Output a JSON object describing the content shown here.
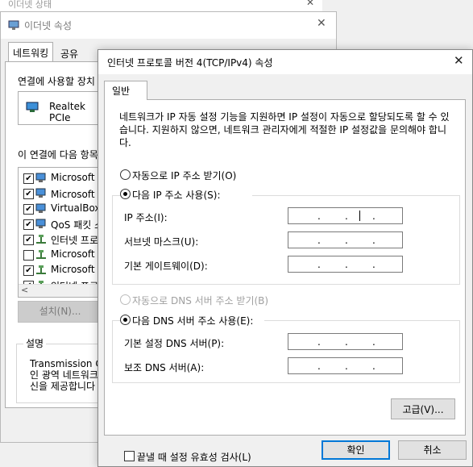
{
  "status_window": {
    "title": "이더넷 상태"
  },
  "properties_window": {
    "title": "이더넷 속성",
    "tabs": [
      "네트워킹",
      "공유"
    ],
    "connect_using_label": "연결에 사용할 장치",
    "adapter_name": "Realtek PCIe",
    "items_label": "이 연결에 다음 항목",
    "items": [
      {
        "label": "Microsoft N",
        "checked": true,
        "icon": "network-client-icon"
      },
      {
        "label": "Microsoft 파",
        "checked": true,
        "icon": "network-client-icon"
      },
      {
        "label": "VirtualBox",
        "checked": true,
        "icon": "network-client-icon"
      },
      {
        "label": "QoS 패킷 스",
        "checked": true,
        "icon": "network-client-icon"
      },
      {
        "label": "인터넷 프로",
        "checked": true,
        "icon": "protocol-icon"
      },
      {
        "label": "Microsoft I",
        "checked": false,
        "icon": "protocol-icon"
      },
      {
        "label": "Microsoft L",
        "checked": true,
        "icon": "protocol-icon"
      },
      {
        "label": "인터넷 프로",
        "checked": true,
        "icon": "protocol-icon"
      }
    ],
    "install_button": "설치(N)...",
    "description_title": "설명",
    "description_lines": [
      "Transmission Co",
      "인 광역 네트워크",
      "신을 제공합니다"
    ]
  },
  "ipv4_window": {
    "title": "인터넷 프로토콜 버전 4(TCP/IPv4) 속성",
    "close_glyph": "✕",
    "tab_general": "일반",
    "intro_text": "네트워크가 IP 자동 설정 기능을 지원하면 IP 설정이 자동으로 할당되도록 할 수 있습니다. 지원하지 않으면, 네트워크 관리자에게 적절한 IP 설정값을 문의해야 합니다.",
    "ip_auto": {
      "label": "자동으로 IP 주소 받기(O)",
      "selected": false
    },
    "ip_manual": {
      "label": "다음 IP 주소 사용(S):",
      "selected": true
    },
    "ip_fields": [
      {
        "label": "IP 주소(I):",
        "value": ". . ."
      },
      {
        "label": "서브넷 마스크(U):",
        "value": ". . ."
      },
      {
        "label": "기본 게이트웨이(D):",
        "value": ". . ."
      }
    ],
    "dns_auto": {
      "label": "자동으로 DNS 서버 주소 받기(B)",
      "selected": false,
      "disabled": true
    },
    "dns_manual": {
      "label": "다음 DNS 서버 주소 사용(E):",
      "selected": true
    },
    "dns_fields": [
      {
        "label": "기본 설정 DNS 서버(P):",
        "value": ". . ."
      },
      {
        "label": "보조 DNS 서버(A):",
        "value": ". . ."
      }
    ],
    "validate_label": "끝낼 때 설정 유효성 검사(L)",
    "validate_checked": false,
    "advanced_button": "고급(V)...",
    "ok_button": "확인",
    "cancel_button": "취소"
  },
  "colors": {
    "accent": "#0078d7",
    "disabled_text": "#a0a0a0",
    "window_bg": "#f0f0f0"
  }
}
